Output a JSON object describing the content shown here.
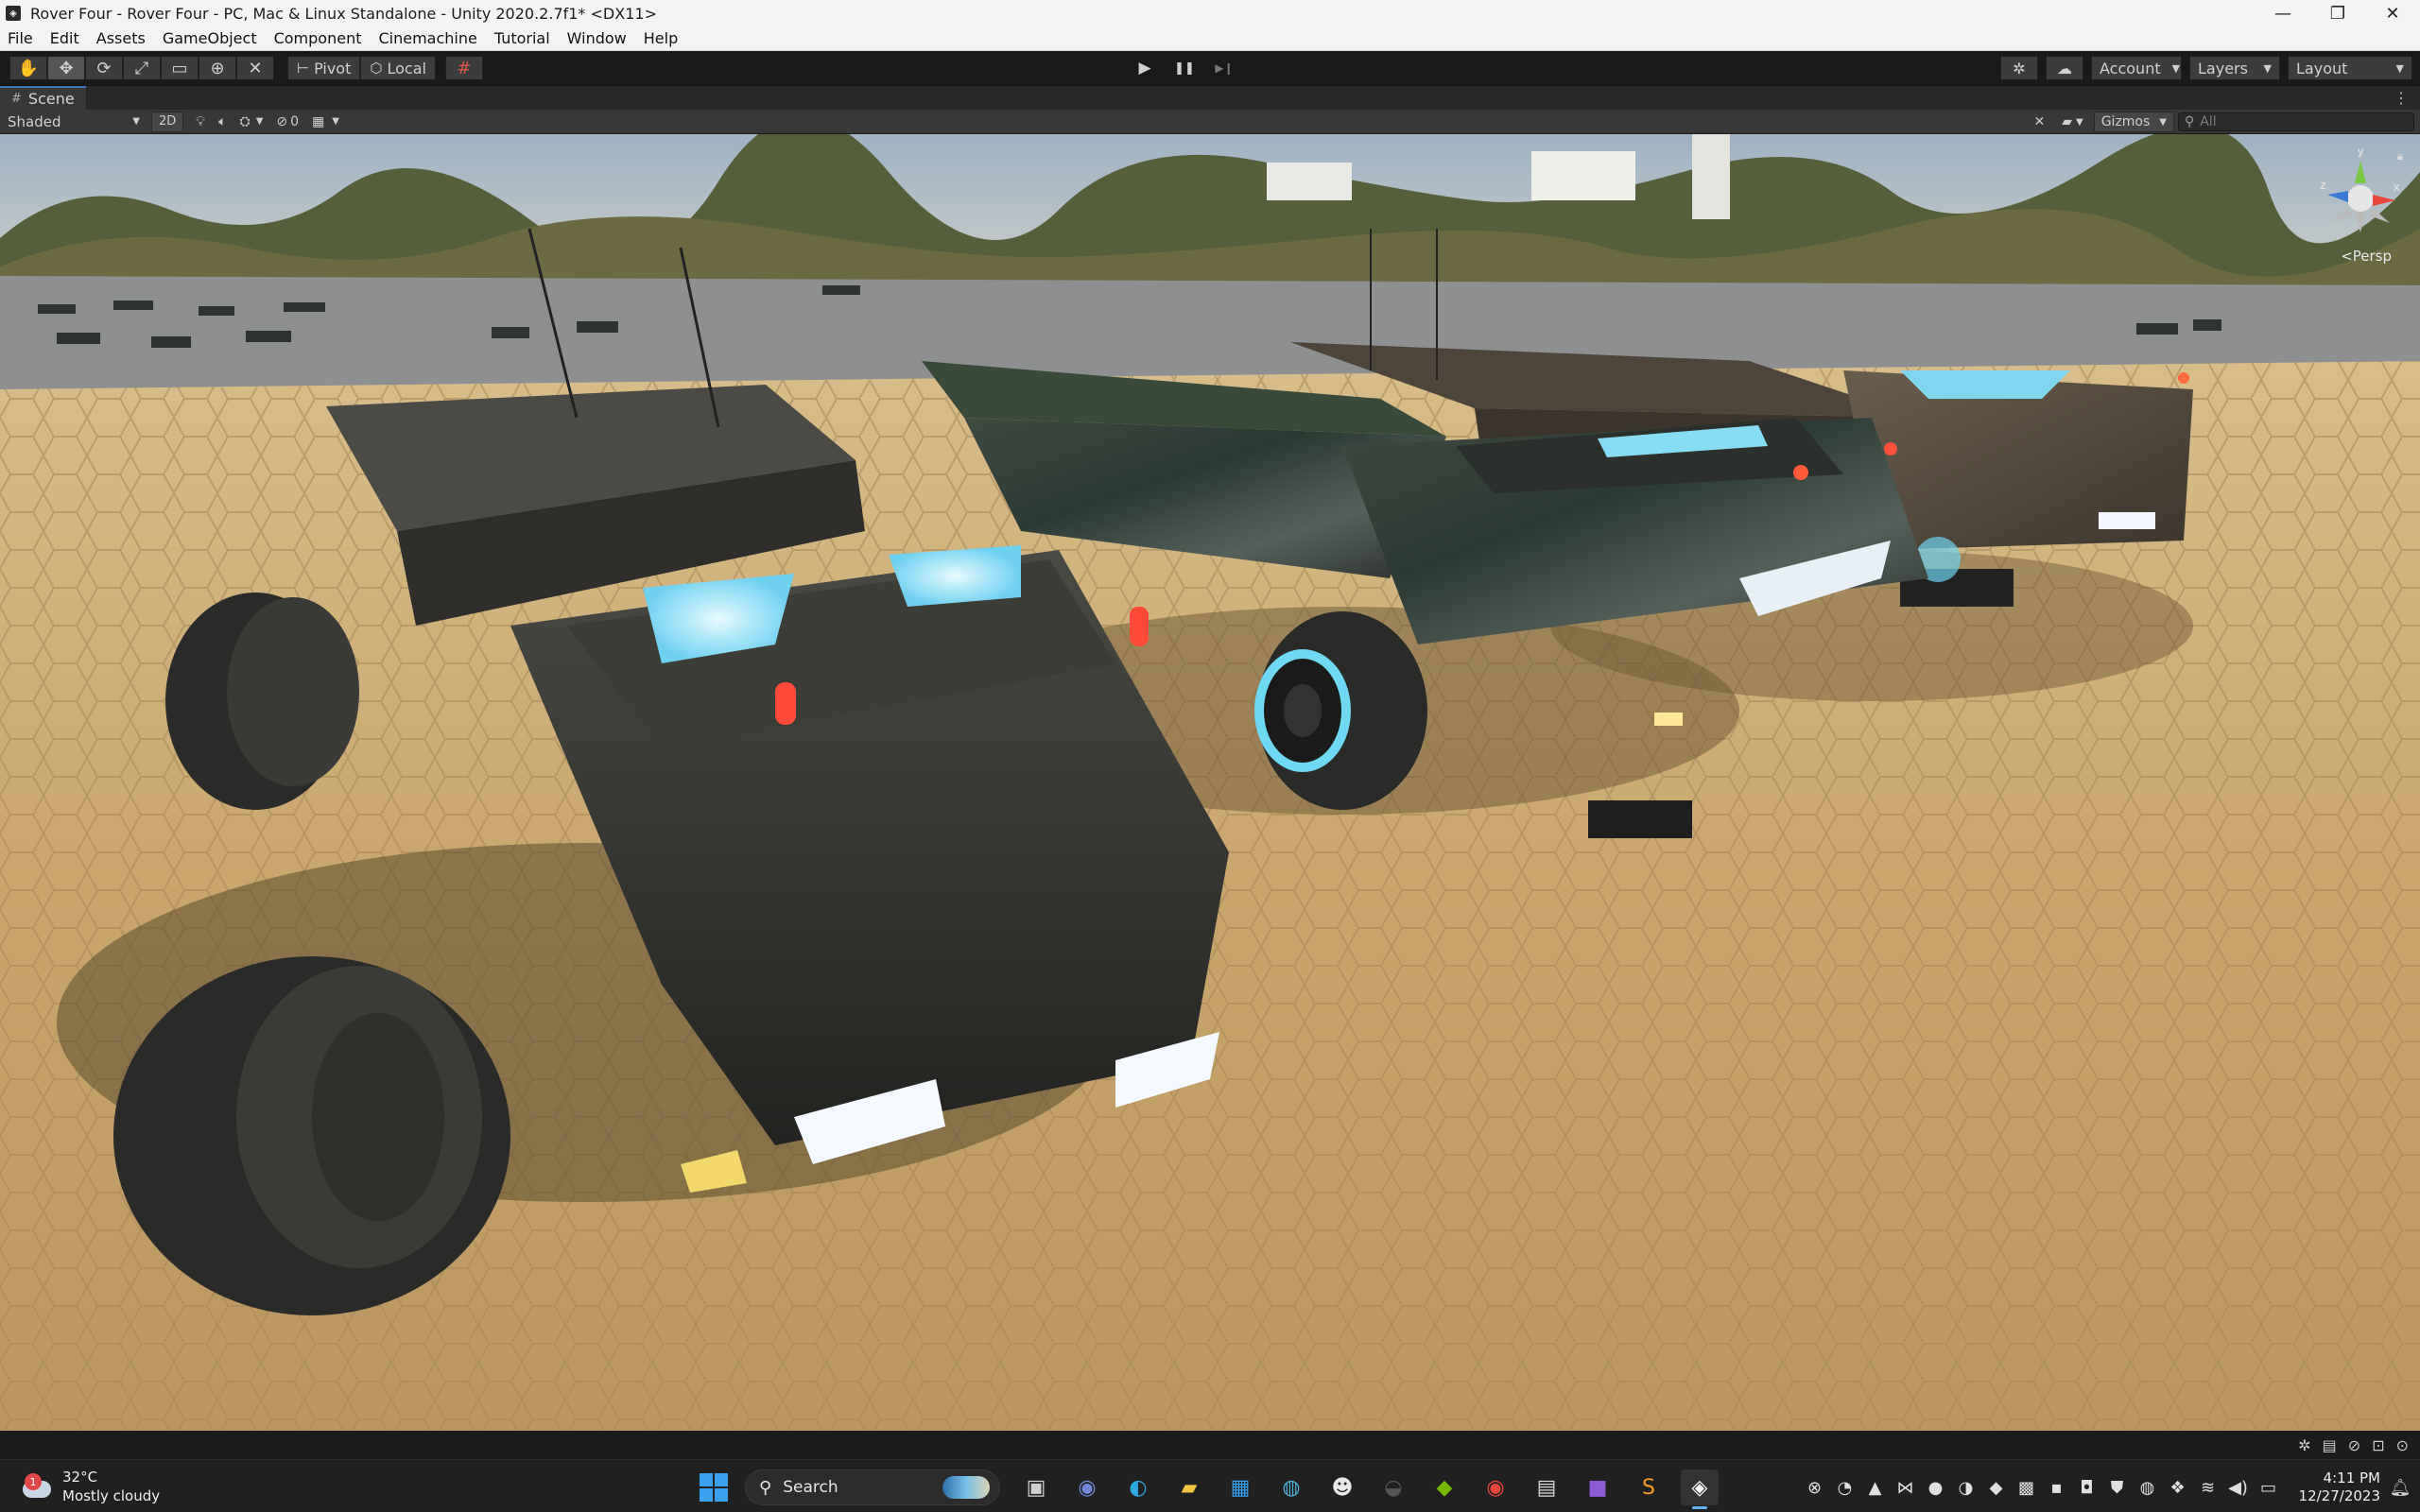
{
  "window": {
    "title": "Rover Four - Rover Four - PC, Mac & Linux Standalone - Unity 2020.2.7f1* <DX11>",
    "minimize": "—",
    "maximize": "❐",
    "close": "✕"
  },
  "menu": [
    "File",
    "Edit",
    "Assets",
    "GameObject",
    "Component",
    "Cinemachine",
    "Tutorial",
    "Window",
    "Help"
  ],
  "toolbar": {
    "tools": [
      {
        "name": "hand-tool-icon",
        "glyph": "✋"
      },
      {
        "name": "move-tool-icon",
        "glyph": "✥"
      },
      {
        "name": "rotate-tool-icon",
        "glyph": "⟳"
      },
      {
        "name": "scale-tool-icon",
        "glyph": "⤢"
      },
      {
        "name": "rect-tool-icon",
        "glyph": "▭"
      },
      {
        "name": "transform-tool-icon",
        "glyph": "⊕"
      },
      {
        "name": "custom-tool-icon",
        "glyph": "✕"
      }
    ],
    "pivot_label": "Pivot",
    "local_label": "Local",
    "play_glyph": "▶",
    "pause_glyph": "❚❚",
    "step_glyph": "▶❙",
    "account_label": "Account",
    "layers_label": "Layers",
    "layout_label": "Layout"
  },
  "scene": {
    "tab_label": "Scene",
    "shading_mode": "Shaded",
    "mode_2d": "2D",
    "hidden_count": "0",
    "gizmos_label": "Gizmos",
    "search_placeholder": "All",
    "camera_label": "<Persp",
    "axis_y": "y",
    "axis_x": "x",
    "axis_z": "z"
  },
  "taskbar": {
    "weather_temp": "32°C",
    "weather_condition": "Mostly cloudy",
    "weather_badge": "1",
    "search_label": "Search",
    "time": "4:11 PM",
    "date": "12/27/2023",
    "apps": [
      {
        "name": "task-view-icon",
        "glyph": "▣",
        "color": "#d0d0d0"
      },
      {
        "name": "discord-icon",
        "glyph": "◉",
        "color": "#7289da"
      },
      {
        "name": "edge-icon",
        "glyph": "◐",
        "color": "#2fa7e0"
      },
      {
        "name": "file-explorer-icon",
        "glyph": "▰",
        "color": "#f5c542"
      },
      {
        "name": "store-icon",
        "glyph": "▦",
        "color": "#3aa0f0"
      },
      {
        "name": "browser-icon",
        "glyph": "◍",
        "color": "#4fb0d8"
      },
      {
        "name": "alien-app-icon",
        "glyph": "☻",
        "color": "#e8e8e8"
      },
      {
        "name": "dark-app-icon",
        "glyph": "◒",
        "color": "#555555"
      },
      {
        "name": "nvidia-icon",
        "glyph": "◆",
        "color": "#76b900"
      },
      {
        "name": "chrome-icon",
        "glyph": "◉",
        "color": "#e8463a"
      },
      {
        "name": "notes-app-icon",
        "glyph": "▤",
        "color": "#d8d8d8"
      },
      {
        "name": "purple-app-icon",
        "glyph": "■",
        "color": "#8e5bd6"
      },
      {
        "name": "sublime-icon",
        "glyph": "S",
        "color": "#f59a23"
      },
      {
        "name": "unity-icon",
        "glyph": "◈",
        "color": "#ffffff"
      }
    ],
    "tray": [
      {
        "name": "xbox-tray-icon",
        "glyph": "⊗"
      },
      {
        "name": "tray-app-icon-1",
        "glyph": "◔"
      },
      {
        "name": "tray-app-icon-2",
        "glyph": "▲"
      },
      {
        "name": "visual-studio-tray-icon",
        "glyph": "⋈"
      },
      {
        "name": "tray-app-icon-3",
        "glyph": "●"
      },
      {
        "name": "tray-app-icon-4",
        "glyph": "◑"
      },
      {
        "name": "tray-app-icon-5",
        "glyph": "◆"
      },
      {
        "name": "tray-app-icon-6",
        "glyph": "▩"
      },
      {
        "name": "tray-app-icon-7",
        "glyph": "▪"
      },
      {
        "name": "tray-app-icon-8",
        "glyph": "◘"
      },
      {
        "name": "tray-app-icon-9",
        "glyph": "⛊"
      },
      {
        "name": "tray-app-icon-10",
        "glyph": "◍"
      },
      {
        "name": "dropbox-tray-icon",
        "glyph": "❖"
      },
      {
        "name": "wifi-icon",
        "glyph": "≋"
      },
      {
        "name": "volume-icon",
        "glyph": "◀)"
      },
      {
        "name": "battery-icon",
        "glyph": "▭"
      }
    ]
  }
}
